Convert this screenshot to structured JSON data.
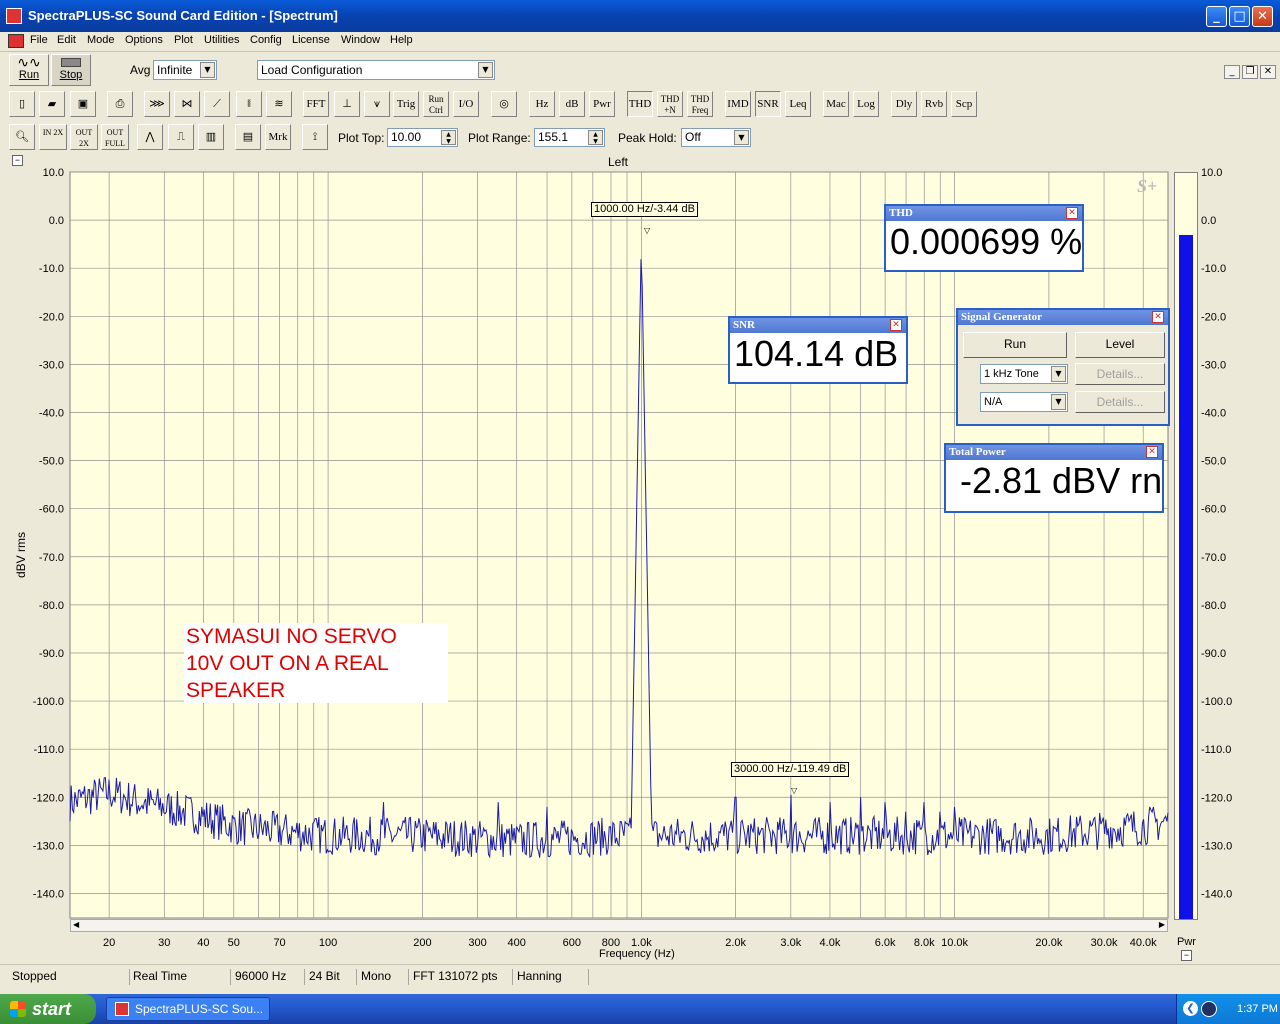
{
  "window": {
    "title": "SpectraPLUS-SC Sound Card Edition - [Spectrum]",
    "min": "_",
    "max": "□",
    "close": "✕"
  },
  "menu": [
    "File",
    "Edit",
    "Mode",
    "Options",
    "Plot",
    "Utilities",
    "Config",
    "License",
    "Window",
    "Help"
  ],
  "toolbar1": {
    "run": "Run",
    "stop": "Stop",
    "avg_label": "Avg",
    "avg_value": "Infinite",
    "load_config": "Load Configuration"
  },
  "toolbar2": [
    "FFT",
    "Trig",
    "Run Ctrl",
    "I/O",
    "Hz",
    "dB",
    "Pwr",
    "THD",
    "THD +N",
    "THD Freq",
    "IMD",
    "SNR",
    "Leq",
    "Mac",
    "Log",
    "Dly",
    "Rvb",
    "Scp"
  ],
  "toolbar3": {
    "zoom_in": "IN 2X",
    "zoom_out": "OUT 2X",
    "zoom_full": "OUT FULL",
    "mrk": "Mrk",
    "plot_top_label": "Plot Top:",
    "plot_top_value": "10.00",
    "plot_range_label": "Plot Range:",
    "plot_range_value": "155.1",
    "peak_hold_label": "Peak Hold:",
    "peak_hold_value": "Off"
  },
  "plot": {
    "channel": "Left",
    "logo": "S+",
    "pwr_label": "Pwr",
    "pwr_level_db": -2.81,
    "marker1": "1000.00 Hz/-3.44 dB",
    "marker2": "3000.00 Hz/-119.49 dB",
    "annotation": [
      "SYMASUI NO SERVO",
      "10V OUT ON A REAL",
      "SPEAKER"
    ]
  },
  "chart_data": {
    "type": "line",
    "title": "",
    "xlabel": "Frequency (Hz)",
    "ylabel": "dBV rms",
    "xscale": "log",
    "xlim": [
      15,
      48000
    ],
    "ylim": [
      -145.1,
      10
    ],
    "yticks": [
      "10.0",
      "0.0",
      "-10.0",
      "-20.0",
      "-30.0",
      "-40.0",
      "-50.0",
      "-60.0",
      "-70.0",
      "-80.0",
      "-90.0",
      "-100.0",
      "-110.0",
      "-120.0",
      "-130.0",
      "-140.0"
    ],
    "xticks": [
      "20",
      "30",
      "40",
      "50",
      "70",
      "100",
      "200",
      "300",
      "400",
      "600",
      "800",
      "1.0k",
      "2.0k",
      "3.0k",
      "4.0k",
      "6.0k",
      "8.0k",
      "10.0k",
      "20.0k",
      "30.0k",
      "40.0k"
    ],
    "pwr_ticks": [
      "10.0",
      "0.0",
      "-10.0",
      "-20.0",
      "-30.0",
      "-40.0",
      "-50.0",
      "-60.0",
      "-70.0",
      "-80.0",
      "-90.0",
      "-100.0",
      "-110.0",
      "-120.0",
      "-130.0",
      "-140.0"
    ],
    "noise_floor": [
      [
        15,
        -121
      ],
      [
        20,
        -119
      ],
      [
        25,
        -121
      ],
      [
        30,
        -122
      ],
      [
        40,
        -124
      ],
      [
        50,
        -126
      ],
      [
        70,
        -127
      ],
      [
        100,
        -128
      ],
      [
        200,
        -128
      ],
      [
        400,
        -129
      ],
      [
        900,
        -128
      ],
      [
        3000,
        -128
      ],
      [
        10000,
        -128
      ],
      [
        20000,
        -128
      ],
      [
        40000,
        -126
      ],
      [
        48000,
        -125
      ]
    ],
    "peaks": [
      [
        1000,
        -3.44
      ],
      [
        2000,
        -120
      ],
      [
        3000,
        -119.49
      ],
      [
        4000,
        -121
      ],
      [
        5000,
        -120
      ],
      [
        6000,
        -121
      ],
      [
        7000,
        -123
      ],
      [
        8000,
        -121
      ],
      [
        9000,
        -123
      ],
      [
        10000,
        -122
      ],
      [
        500,
        -122
      ],
      [
        350,
        -121
      ],
      [
        150,
        -121
      ]
    ],
    "grid": true
  },
  "thd": {
    "title": "THD",
    "value": "0.000699 %"
  },
  "snr": {
    "title": "SNR",
    "value": "104.14 dB"
  },
  "siggen": {
    "title": "Signal Generator",
    "run": "Run",
    "level": "Level",
    "tone": "1 kHz Tone",
    "na": "N/A",
    "details": "Details..."
  },
  "totpower": {
    "title": "Total Power",
    "value": "-2.81 dBV rn"
  },
  "status": [
    "Stopped",
    "Real Time",
    "96000 Hz",
    "24 Bit",
    "Mono",
    "FFT 131072 pts",
    "Hanning"
  ],
  "taskbar": {
    "start": "start",
    "item": "SpectraPLUS-SC Sou...",
    "time": "1:37 PM"
  }
}
